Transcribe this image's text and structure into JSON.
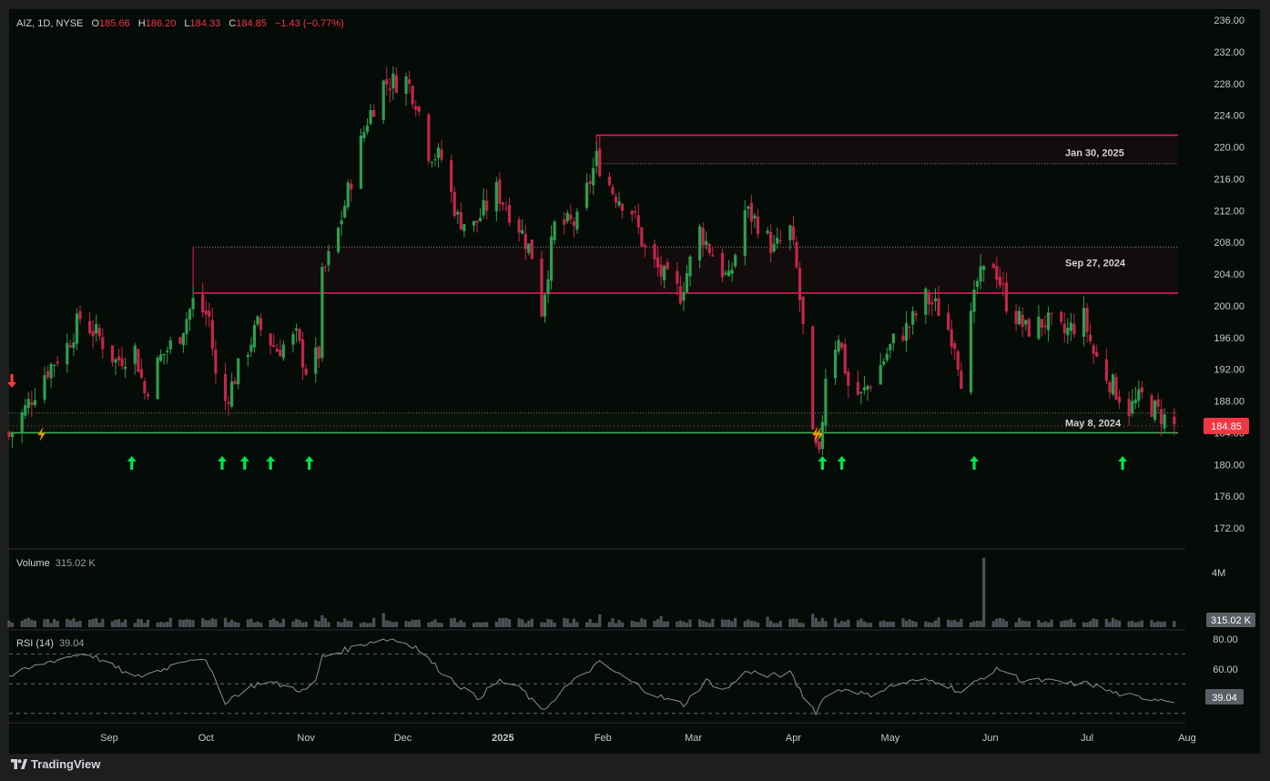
{
  "symbol": {
    "ticker": "AIZ",
    "interval": "1D",
    "exchange": "NYSE",
    "open_label": "O",
    "open": "185.66",
    "high_label": "H",
    "high": "186.20",
    "low_label": "L",
    "low": "184.33",
    "close_label": "C",
    "close": "184.85",
    "change": "−1.43 (−0.77%)"
  },
  "volume_pane": {
    "title": "Volume",
    "value": "315.02 K",
    "axis_label": "4M",
    "last_tag": "315.02 K"
  },
  "rsi_pane": {
    "title": "RSI (14)",
    "value": "39.04",
    "axis_labels": [
      "80.00",
      "60.00"
    ],
    "last_tag": "39.04"
  },
  "brand": {
    "name": "TradingView"
  },
  "colors": {
    "background": "#050b07",
    "up": "#26a69a",
    "up_candle": "#2e9e4e",
    "down": "#c2274a",
    "price_tag": "#f23645",
    "support_line": "#4caf50",
    "resistance_line": "#e91e63",
    "signal_arrow": "#00e64d",
    "bolt": "#ff9800"
  },
  "chart_data": {
    "type": "candlestick",
    "y_axis_ticks": [
      "236.00",
      "232.00",
      "228.00",
      "224.00",
      "220.00",
      "216.00",
      "212.00",
      "208.00",
      "204.00",
      "200.00",
      "196.00",
      "192.00",
      "188.00",
      "184.00",
      "180.00",
      "176.00",
      "172.00"
    ],
    "ylim": [
      170.5,
      236.8
    ],
    "x_range": [
      "2024-08-01",
      "2025-08-01"
    ],
    "x_axis_labels": [
      {
        "label": "Sep",
        "date": "2024-09-01",
        "bold": false
      },
      {
        "label": "Oct",
        "date": "2024-10-01",
        "bold": false
      },
      {
        "label": "Nov",
        "date": "2024-11-01",
        "bold": false
      },
      {
        "label": "Dec",
        "date": "2024-12-01",
        "bold": false
      },
      {
        "label": "2025",
        "date": "2025-01-01",
        "bold": true
      },
      {
        "label": "Feb",
        "date": "2025-02-01",
        "bold": false
      },
      {
        "label": "Mar",
        "date": "2025-03-01",
        "bold": false
      },
      {
        "label": "Apr",
        "date": "2025-04-01",
        "bold": false
      },
      {
        "label": "May",
        "date": "2025-05-01",
        "bold": false
      },
      {
        "label": "Jun",
        "date": "2025-06-01",
        "bold": false
      },
      {
        "label": "Jul",
        "date": "2025-07-01",
        "bold": false
      },
      {
        "label": "Aug",
        "date": "2025-08-01",
        "bold": false
      }
    ],
    "last_price": 184.85,
    "zones": [
      {
        "label": "Jan 30, 2025",
        "start": "2025-01-30",
        "top": 221.5,
        "bottom": 217.9
      },
      {
        "label": "Sep 27, 2024",
        "start": "2024-09-27",
        "top": 207.4,
        "bottom": 201.6
      },
      {
        "label": "May 8, 2024",
        "start": "2024-08-01",
        "top": 186.5,
        "bottom": 184.0
      }
    ],
    "close_path": [
      [
        "2024-08-01",
        183.5
      ],
      [
        "2024-08-06",
        187.0
      ],
      [
        "2024-08-12",
        191.5
      ],
      [
        "2024-08-19",
        195.0
      ],
      [
        "2024-08-23",
        198.5
      ],
      [
        "2024-08-29",
        196.0
      ],
      [
        "2024-09-03",
        193.0
      ],
      [
        "2024-09-09",
        194.5
      ],
      [
        "2024-09-12",
        189.0
      ],
      [
        "2024-09-17",
        193.5
      ],
      [
        "2024-09-23",
        196.5
      ],
      [
        "2024-09-27",
        200.5
      ],
      [
        "2024-10-02",
        198.5
      ],
      [
        "2024-10-04",
        191.0
      ],
      [
        "2024-10-07",
        188.0
      ],
      [
        "2024-10-11",
        192.0
      ],
      [
        "2024-10-17",
        197.5
      ],
      [
        "2024-10-23",
        194.5
      ],
      [
        "2024-10-29",
        196.0
      ],
      [
        "2024-11-01",
        192.0
      ],
      [
        "2024-11-05",
        194.0
      ],
      [
        "2024-11-06",
        203.5
      ],
      [
        "2024-11-11",
        209.5
      ],
      [
        "2024-11-15",
        216.0
      ],
      [
        "2024-11-20",
        223.5
      ],
      [
        "2024-11-25",
        228.0
      ],
      [
        "2024-12-02",
        228.5
      ],
      [
        "2024-12-05",
        226.0
      ],
      [
        "2024-12-09",
        219.5
      ],
      [
        "2024-12-13",
        218.5
      ],
      [
        "2024-12-18",
        211.0
      ],
      [
        "2024-12-23",
        210.0
      ],
      [
        "2024-12-30",
        214.5
      ],
      [
        "2025-01-06",
        210.0
      ],
      [
        "2025-01-10",
        206.5
      ],
      [
        "2025-01-13",
        199.5
      ],
      [
        "2025-01-17",
        210.0
      ],
      [
        "2025-01-24",
        210.5
      ],
      [
        "2025-01-30",
        218.5
      ],
      [
        "2025-02-04",
        214.5
      ],
      [
        "2025-02-10",
        212.0
      ],
      [
        "2025-02-14",
        207.0
      ],
      [
        "2025-02-19",
        204.0
      ],
      [
        "2025-02-25",
        201.5
      ],
      [
        "2025-03-03",
        209.5
      ],
      [
        "2025-03-07",
        206.5
      ],
      [
        "2025-03-12",
        203.0
      ],
      [
        "2025-03-17",
        212.0
      ],
      [
        "2025-03-21",
        210.5
      ],
      [
        "2025-03-26",
        207.0
      ],
      [
        "2025-03-31",
        209.5
      ],
      [
        "2025-04-02",
        204.5
      ],
      [
        "2025-04-04",
        197.0
      ],
      [
        "2025-04-07",
        183.0
      ],
      [
        "2025-04-09",
        180.5
      ],
      [
        "2025-04-11",
        191.5
      ],
      [
        "2025-04-15",
        196.5
      ],
      [
        "2025-04-18",
        190.0
      ],
      [
        "2025-04-22",
        188.5
      ],
      [
        "2025-04-28",
        192.5
      ],
      [
        "2025-05-02",
        195.5
      ],
      [
        "2025-05-07",
        197.5
      ],
      [
        "2025-05-12",
        201.0
      ],
      [
        "2025-05-16",
        199.5
      ],
      [
        "2025-05-21",
        195.5
      ],
      [
        "2025-05-23",
        191.0
      ],
      [
        "2025-05-28",
        203.0
      ],
      [
        "2025-06-02",
        205.5
      ],
      [
        "2025-06-06",
        200.5
      ],
      [
        "2025-06-12",
        197.0
      ],
      [
        "2025-06-18",
        198.0
      ],
      [
        "2025-06-24",
        196.5
      ],
      [
        "2025-06-30",
        198.5
      ],
      [
        "2025-07-03",
        194.0
      ],
      [
        "2025-07-08",
        190.5
      ],
      [
        "2025-07-14",
        187.0
      ],
      [
        "2025-07-18",
        188.5
      ],
      [
        "2025-07-23",
        186.5
      ],
      [
        "2025-07-28",
        184.85
      ]
    ],
    "buy_signals": [
      "2024-09-08",
      "2024-10-06",
      "2024-10-13",
      "2024-10-21",
      "2024-11-02",
      "2025-04-10",
      "2025-04-16",
      "2025-05-27",
      "2025-07-12"
    ],
    "bolt_markers": [
      "2024-08-11",
      "2025-04-08",
      "2025-04-09"
    ],
    "sell_signals": [
      "2024-08-01"
    ],
    "volume": {
      "ylim_millions": [
        0,
        4.7
      ],
      "typical": 0.45,
      "spikes": [
        [
          "2025-05-30",
          4.65
        ],
        [
          "2024-11-25",
          0.95
        ],
        [
          "2025-01-31",
          0.85
        ],
        [
          "2025-04-07",
          0.9
        ],
        [
          "2025-02-19",
          0.75
        ],
        [
          "2024-11-06",
          0.8
        ],
        [
          "2025-03-24",
          0.7
        ],
        [
          "2025-05-16",
          0.65
        ]
      ]
    },
    "rsi": {
      "ylim": [
        25,
        85
      ],
      "levels": [
        70,
        50,
        30
      ],
      "path": [
        [
          "2024-08-01",
          55
        ],
        [
          "2024-08-12",
          64
        ],
        [
          "2024-08-19",
          68
        ],
        [
          "2024-08-25",
          71
        ],
        [
          "2024-09-02",
          62
        ],
        [
          "2024-09-09",
          54
        ],
        [
          "2024-09-18",
          60
        ],
        [
          "2024-09-24",
          66
        ],
        [
          "2024-09-30",
          68
        ],
        [
          "2024-10-04",
          52
        ],
        [
          "2024-10-07",
          38
        ],
        [
          "2024-10-13",
          46
        ],
        [
          "2024-10-19",
          52
        ],
        [
          "2024-10-26",
          48
        ],
        [
          "2024-11-03",
          44
        ],
        [
          "2024-11-06",
          68
        ],
        [
          "2024-11-15",
          74
        ],
        [
          "2024-11-22",
          79
        ],
        [
          "2024-11-28",
          80
        ],
        [
          "2024-12-05",
          75
        ],
        [
          "2024-12-12",
          60
        ],
        [
          "2024-12-19",
          48
        ],
        [
          "2024-12-24",
          40
        ],
        [
          "2024-12-31",
          52
        ],
        [
          "2025-01-07",
          46
        ],
        [
          "2025-01-13",
          31
        ],
        [
          "2025-01-20",
          47
        ],
        [
          "2025-01-27",
          58
        ],
        [
          "2025-01-31",
          64
        ],
        [
          "2025-02-07",
          55
        ],
        [
          "2025-02-14",
          46
        ],
        [
          "2025-02-20",
          40
        ],
        [
          "2025-02-26",
          36
        ],
        [
          "2025-03-05",
          52
        ],
        [
          "2025-03-11",
          46
        ],
        [
          "2025-03-18",
          59
        ],
        [
          "2025-03-24",
          55
        ],
        [
          "2025-03-31",
          57
        ],
        [
          "2025-04-04",
          42
        ],
        [
          "2025-04-08",
          31
        ],
        [
          "2025-04-11",
          43
        ],
        [
          "2025-04-18",
          47
        ],
        [
          "2025-04-24",
          42
        ],
        [
          "2025-05-02",
          49
        ],
        [
          "2025-05-09",
          52
        ],
        [
          "2025-05-16",
          52
        ],
        [
          "2025-05-23",
          44
        ],
        [
          "2025-05-30",
          55
        ],
        [
          "2025-06-04",
          60
        ],
        [
          "2025-06-11",
          52
        ],
        [
          "2025-06-18",
          52
        ],
        [
          "2025-06-25",
          50
        ],
        [
          "2025-07-02",
          50
        ],
        [
          "2025-07-09",
          44
        ],
        [
          "2025-07-16",
          41
        ],
        [
          "2025-07-23",
          40
        ],
        [
          "2025-07-28",
          39.04
        ]
      ]
    }
  }
}
